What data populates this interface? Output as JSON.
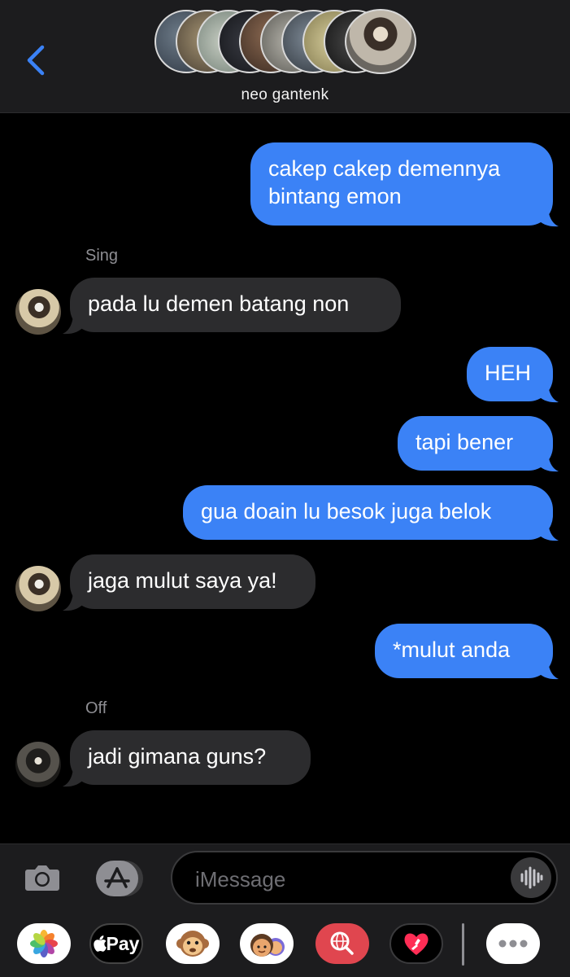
{
  "header": {
    "back_icon": "chevron-left-icon",
    "group_name": "neo gantenk",
    "accent": "#3b82f6"
  },
  "messages": [
    {
      "type": "out",
      "lines": [
        "cakep cakep demennya",
        "bintang emon"
      ]
    },
    {
      "type": "in",
      "sender": "Sing",
      "text": "pada lu demen batang non"
    },
    {
      "type": "out",
      "text": "HEH"
    },
    {
      "type": "out",
      "text": "tapi bener"
    },
    {
      "type": "out",
      "text": "gua doain lu besok juga belok"
    },
    {
      "type": "in",
      "text": "jaga mulut saya ya!"
    },
    {
      "type": "out",
      "text": "*mulut anda"
    },
    {
      "type": "in",
      "sender": "Off",
      "text": "jadi gimana guns?"
    }
  ],
  "input": {
    "placeholder": "iMessage",
    "camera_icon": "camera-icon",
    "appstore_icon": "app-store-icon",
    "voice_icon": "audio-waveform-icon"
  },
  "drawer": {
    "applepay_label": "Pay",
    "apps": [
      "photos-icon",
      "apple-pay-icon",
      "monkey-animoji-icon",
      "memoji-icon",
      "web-search-icon",
      "digital-touch-icon",
      "more-icon"
    ]
  },
  "colors": {
    "outgoing_bubble": "#3b82f6",
    "incoming_bubble": "#2c2c2e",
    "background": "#000000",
    "bar": "#1c1c1e"
  }
}
